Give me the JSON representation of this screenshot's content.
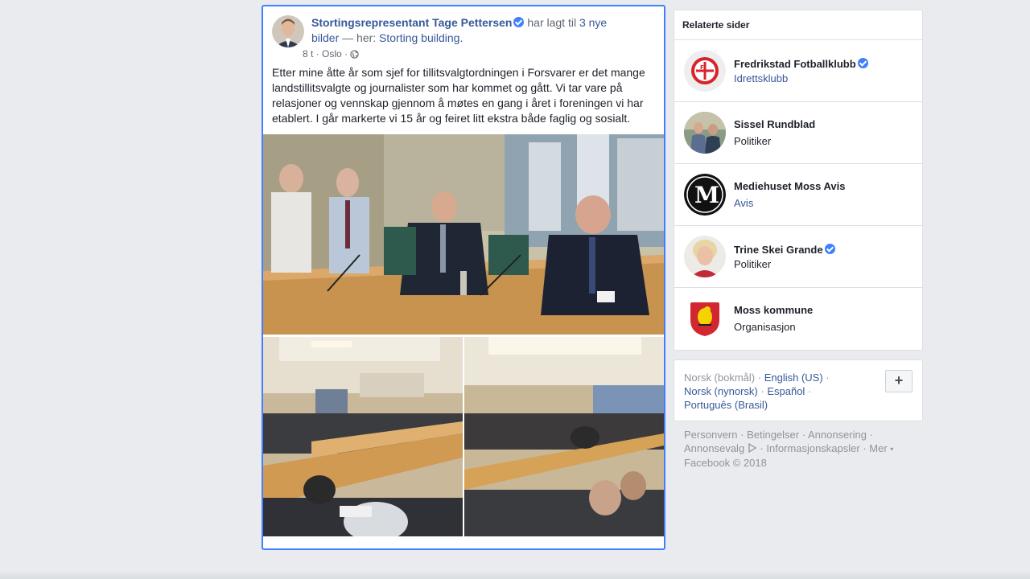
{
  "post": {
    "author": "Stortingsrepresentant Tage Pettersen",
    "action_prefix": "har lagt til",
    "action_link": "3 nye",
    "action_link2": "bilder",
    "place_prefix": "— her:",
    "place": "Storting building.",
    "time": "8 t",
    "location": "Oslo",
    "text": "Etter mine åtte år som sjef for tillitsvalgtordningen i Forsvarer er det mange landstillitsvalgte og journalister som har kommet og gått. Vi tar vare på relasjoner og vennskap gjennom å møtes en gang i året i foreningen vi har etablert. I går markerte vi 15 år og feiret litt ekstra både faglig og sosialt."
  },
  "related": {
    "title": "Relaterte sider",
    "items": [
      {
        "name": "Fredrikstad Fotballklubb",
        "verified": true,
        "category": "Idrettsklubb",
        "category_link": true
      },
      {
        "name": "Sissel Rundblad",
        "verified": false,
        "category": "Politiker",
        "category_link": false
      },
      {
        "name": "Mediehuset Moss Avis",
        "verified": false,
        "category": "Avis",
        "category_link": true
      },
      {
        "name": "Trine Skei Grande",
        "verified": true,
        "category": "Politiker",
        "category_link": false
      },
      {
        "name": "Moss kommune",
        "verified": false,
        "category": "Organisasjon",
        "category_link": false
      }
    ]
  },
  "languages": {
    "current": "Norsk (bokmål)",
    "others": [
      "English (US)",
      "Norsk (nynorsk)",
      "Español",
      "Português (Brasil)"
    ],
    "add_label": "+"
  },
  "footer": {
    "links": [
      "Personvern",
      "Betingelser",
      "Annonsering",
      "Annonsevalg",
      "Informasjonskapsler",
      "Mer"
    ],
    "copyright": "Facebook © 2018"
  },
  "colors": {
    "link": "#365899",
    "focus_border": "#4080ff",
    "background": "#e9ebee"
  }
}
